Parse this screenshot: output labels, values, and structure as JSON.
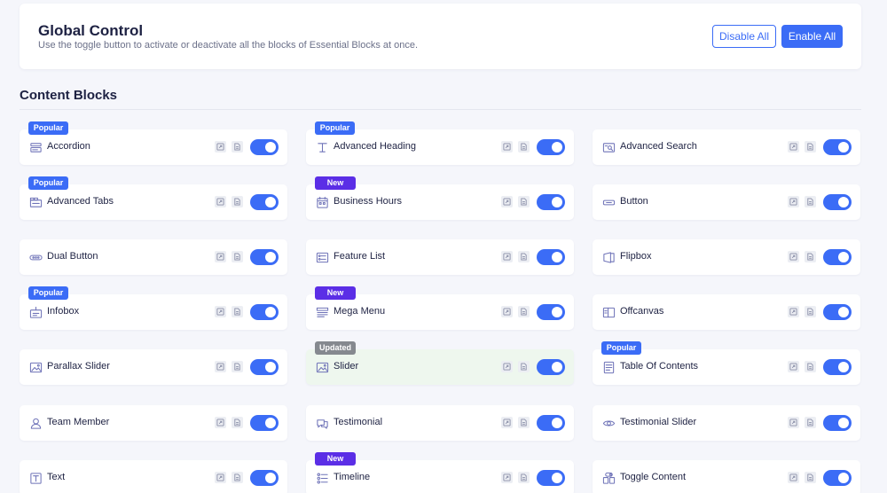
{
  "global": {
    "title": "Global Control",
    "description": "Use the toggle button to activate or deactivate all the blocks of Essential Blocks at once.",
    "disable_label": "Disable All",
    "enable_label": "Enable All"
  },
  "section": {
    "title": "Content Blocks"
  },
  "colors": {
    "accent": "#3b6cf6",
    "badge_popular": "#3b6cf6",
    "badge_new": "#5b2ee6",
    "badge_updated": "#85898f",
    "highlight_row": "#eef7ee"
  },
  "blocks": [
    {
      "name": "Accordion",
      "icon": "accordion-icon",
      "badge": "Popular",
      "badge_type": "popular",
      "enabled": true
    },
    {
      "name": "Advanced Heading",
      "icon": "heading-icon",
      "badge": "Popular",
      "badge_type": "popular",
      "enabled": true
    },
    {
      "name": "Advanced Search",
      "icon": "search-icon",
      "badge": "",
      "badge_type": "",
      "enabled": true
    },
    {
      "name": "Advanced Tabs",
      "icon": "tabs-icon",
      "badge": "Popular",
      "badge_type": "popular",
      "enabled": true
    },
    {
      "name": "Business Hours",
      "icon": "calendar-icon",
      "badge": "New",
      "badge_type": "new",
      "enabled": true
    },
    {
      "name": "Button",
      "icon": "button-icon",
      "badge": "",
      "badge_type": "",
      "enabled": true
    },
    {
      "name": "Dual Button",
      "icon": "dual-button-icon",
      "badge": "",
      "badge_type": "",
      "enabled": true
    },
    {
      "name": "Feature List",
      "icon": "list-icon",
      "badge": "",
      "badge_type": "",
      "enabled": true
    },
    {
      "name": "Flipbox",
      "icon": "flipbox-icon",
      "badge": "",
      "badge_type": "",
      "enabled": true
    },
    {
      "name": "Infobox",
      "icon": "infobox-icon",
      "badge": "Popular",
      "badge_type": "popular",
      "enabled": true
    },
    {
      "name": "Mega Menu",
      "icon": "menu-icon",
      "badge": "New",
      "badge_type": "new",
      "enabled": true
    },
    {
      "name": "Offcanvas",
      "icon": "offcanvas-icon",
      "badge": "",
      "badge_type": "",
      "enabled": true
    },
    {
      "name": "Parallax Slider",
      "icon": "image-icon",
      "badge": "",
      "badge_type": "",
      "enabled": true
    },
    {
      "name": "Slider",
      "icon": "image-icon",
      "badge": "Updated",
      "badge_type": "updated",
      "enabled": true,
      "highlight": true
    },
    {
      "name": "Table Of Contents",
      "icon": "document-icon",
      "badge": "Popular",
      "badge_type": "popular",
      "enabled": true
    },
    {
      "name": "Team Member",
      "icon": "user-icon",
      "badge": "",
      "badge_type": "",
      "enabled": true
    },
    {
      "name": "Testimonial",
      "icon": "testimonial-icon",
      "badge": "",
      "badge_type": "",
      "enabled": true
    },
    {
      "name": "Testimonial Slider",
      "icon": "eye-icon",
      "badge": "",
      "badge_type": "",
      "enabled": true
    },
    {
      "name": "Text",
      "icon": "text-icon",
      "badge": "",
      "badge_type": "",
      "enabled": true
    },
    {
      "name": "Timeline",
      "icon": "timeline-icon",
      "badge": "New",
      "badge_type": "new",
      "enabled": true
    },
    {
      "name": "Toggle Content",
      "icon": "toggle-content-icon",
      "badge": "",
      "badge_type": "",
      "enabled": true
    }
  ]
}
